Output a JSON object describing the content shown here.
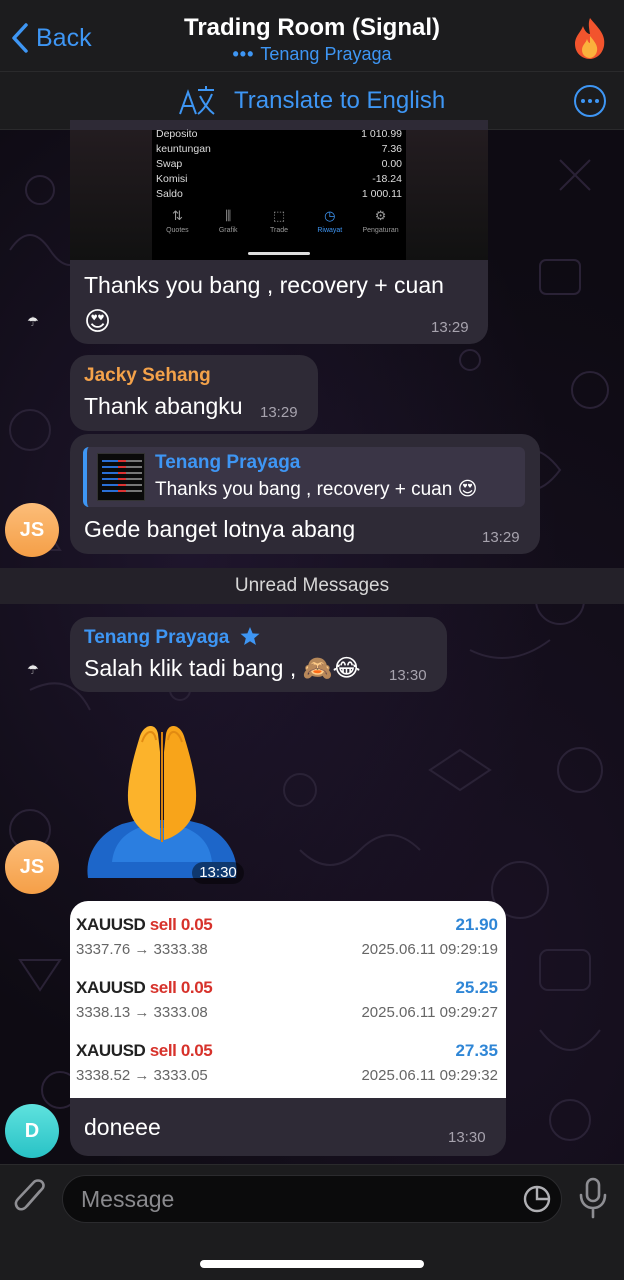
{
  "header": {
    "back_label": "Back",
    "title": "Trading Room (Signal)",
    "subtitle_dots": "•••",
    "subtitle": "Tenang Prayaga",
    "avatar_icon": "fire-icon"
  },
  "translate_bar": {
    "label": "Translate to English",
    "icon": "translate-icon",
    "more_icon": "more-icon"
  },
  "screenshot_rows": [
    {
      "label": "Deposito",
      "value": "1 010.99"
    },
    {
      "label": "keuntungan",
      "value": "7.36"
    },
    {
      "label": "Swap",
      "value": "0.00"
    },
    {
      "label": "Komisi",
      "value": "-18.24"
    },
    {
      "label": "Saldo",
      "value": "1 000.11"
    }
  ],
  "screenshot_nav": [
    {
      "label": "Quotes",
      "icon": "arrows-icon",
      "glyph": "⇅"
    },
    {
      "label": "Grafik",
      "icon": "candles-icon",
      "glyph": "⫼"
    },
    {
      "label": "Trade",
      "icon": "chart-icon",
      "glyph": "⬚"
    },
    {
      "label": "Riwayat",
      "icon": "history-icon",
      "glyph": "◷"
    },
    {
      "label": "Pengaturan",
      "icon": "settings-icon",
      "glyph": "⚙"
    }
  ],
  "messages": {
    "m1": {
      "text": "Thanks you bang , recovery + cuan",
      "emoji": "😍",
      "time": "13:29"
    },
    "m2": {
      "sender": "Jacky Sehang",
      "text": "Thank abangku",
      "time": "13:29"
    },
    "m3": {
      "reply_name": "Tenang Prayaga",
      "reply_text": "Thanks you bang , recovery + cuan 😍",
      "text": "Gede banget lotnya abang",
      "time": "13:29",
      "avatar": "JS"
    },
    "unread_label": "Unread Messages",
    "m4": {
      "sender": "Tenang Prayaga",
      "sender_badge": "star-icon",
      "text": "Salah klik tadi bang ,",
      "emoji": "🙈😂",
      "time": "13:30"
    },
    "m5": {
      "sticker": "folded-hands-sticker",
      "time": "13:30",
      "avatar": "JS"
    },
    "m6": {
      "trades": [
        {
          "symbol": "XAUUSD",
          "side": "sell",
          "lot": "0.05",
          "profit": "21.90",
          "prices": "3337.76 → 3333.38",
          "date": "2025.06.11 09:29:19"
        },
        {
          "symbol": "XAUUSD",
          "side": "sell",
          "lot": "0.05",
          "profit": "25.25",
          "prices": "3338.13 → 3333.08",
          "date": "2025.06.11 09:29:27"
        },
        {
          "symbol": "XAUUSD",
          "side": "sell",
          "lot": "0.05",
          "profit": "27.35",
          "prices": "3338.52 → 3333.05",
          "date": "2025.06.11 09:29:32"
        }
      ],
      "text": "doneee",
      "time": "13:30",
      "avatar": "D"
    }
  },
  "input": {
    "placeholder": "Message",
    "attach_icon": "paperclip-icon",
    "sticker_icon": "sticker-icon",
    "mic_icon": "microphone-icon"
  },
  "colors": {
    "accent": "#3e96f4",
    "bubble": "#2e2a36",
    "sender_orange": "#f4a24a",
    "sell_red": "#d7322b"
  }
}
